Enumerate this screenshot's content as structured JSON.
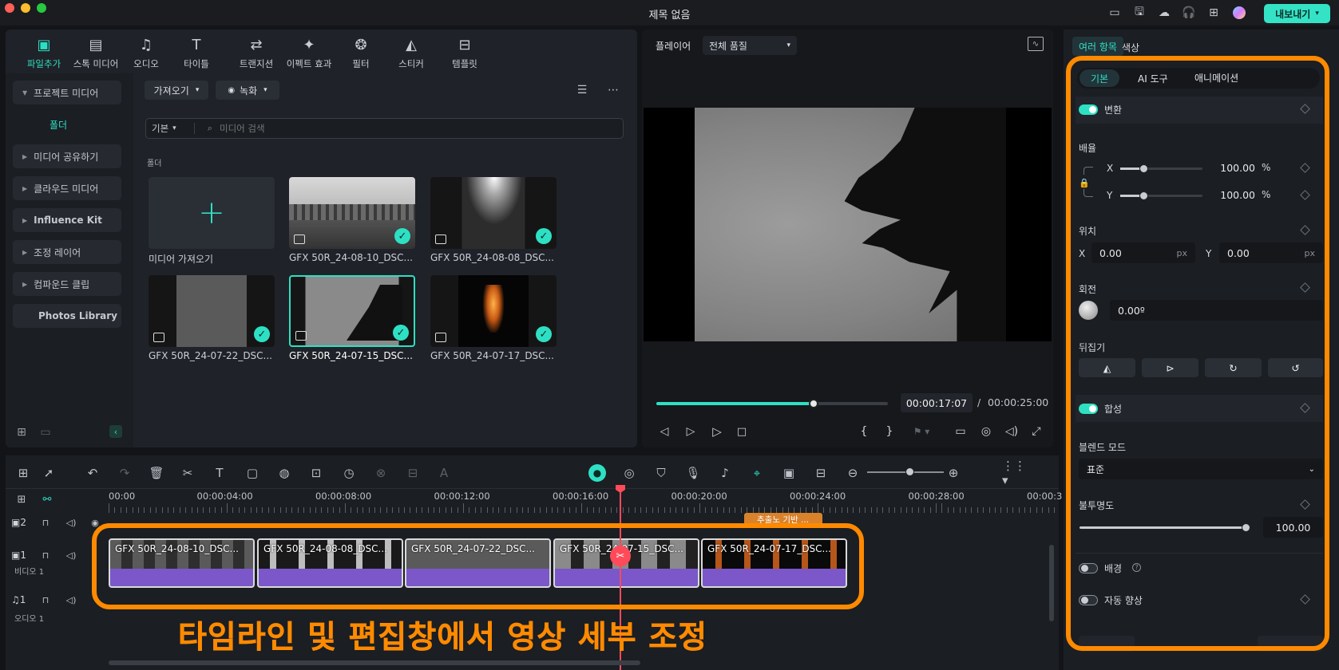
{
  "window": {
    "title": "제목 없음",
    "export_label": "내보내기"
  },
  "toolbar": [
    {
      "label": "파일추가",
      "icon": "media-icon"
    },
    {
      "label": "스톡 미디어",
      "icon": "stock-icon"
    },
    {
      "label": "오디오",
      "icon": "audio-icon"
    },
    {
      "label": "타이틀",
      "icon": "title-icon"
    },
    {
      "label": "트랜지션",
      "icon": "transition-icon"
    },
    {
      "label": "이펙트 효과",
      "icon": "effects-icon"
    },
    {
      "label": "필터",
      "icon": "filter-icon"
    },
    {
      "label": "스티커",
      "icon": "sticker-icon"
    },
    {
      "label": "템플릿",
      "icon": "template-icon"
    }
  ],
  "sidebar": {
    "project_media": "프로젝트 미디어",
    "folder": "폴더",
    "items": [
      "미디어 공유하기",
      "클라우드 미디어",
      "Influence Kit",
      "조정 레이어",
      "컴파운드 클립",
      "Photos Library"
    ]
  },
  "media": {
    "import_dropdown": "가져오기",
    "record_dropdown": "녹화",
    "sort_dropdown": "기본",
    "search_placeholder": "미디어 검색",
    "folder_label": "폴더",
    "import_tile_label": "미디어 가져오기",
    "items": [
      "GFX 50R_24-08-10_DSC...",
      "GFX 50R_24-08-08_DSC...",
      "GFX 50R_24-07-22_DSC...",
      "GFX 50R_24-07-15_DSC...",
      "GFX 50R_24-07-17_DSC..."
    ]
  },
  "player": {
    "label": "플레이어",
    "quality": "전체 품질",
    "current_time": "00:00:17:07",
    "separator": "/",
    "total_time": "00:00:25:00",
    "progress": 0.68
  },
  "properties": {
    "tabs": [
      "여러 항목",
      "색상"
    ],
    "subtabs": [
      "기본",
      "AI 도구",
      "애니메이션"
    ],
    "transform": "변환",
    "scale": "배율",
    "scale_x_label": "X",
    "scale_x": "100.00",
    "scale_y_label": "Y",
    "scale_y": "100.00",
    "percent": "%",
    "position": "위치",
    "pos_x_label": "X",
    "pos_x": "0.00",
    "pos_y_label": "Y",
    "pos_y": "0.00",
    "px": "px",
    "rotation": "회전",
    "rotation_value": "0.00º",
    "flip": "뒤집기",
    "composite": "합성",
    "blend_mode": "블렌드 모드",
    "blend_value": "표준",
    "opacity": "불투명도",
    "opacity_value": "100.00",
    "background": "배경",
    "auto_enhance": "자동 향상"
  },
  "timeline": {
    "ruler": [
      "00:00",
      "00:00:04:00",
      "00:00:08:00",
      "00:00:12:00",
      "00:00:16:00",
      "00:00:20:00",
      "00:00:24:00",
      "00:00:28:00",
      "00:00:3"
    ],
    "track_video": "비디오 1",
    "track_audio": "오디오 1",
    "track2_num": "2",
    "track1_num": "1",
    "audio_num": "1",
    "beat_label": "추출노 기반 ...",
    "clips": [
      "GFX 50R_24-08-10_DSC...",
      "GFX 50R_24-08-08_DSC...",
      "GFX 50R_24-07-22_DSC...",
      "GFX 50R_24-07-15_DSC...",
      "GFX 50R_24-07-17_DSC..."
    ]
  },
  "caption": "타임라인 및 편집창에서 영상 세부 조정",
  "colors": {
    "accent": "#2ee0c3",
    "highlight": "#ff8a00",
    "playhead": "#ff4a5a",
    "clip": "#7b57c9"
  }
}
